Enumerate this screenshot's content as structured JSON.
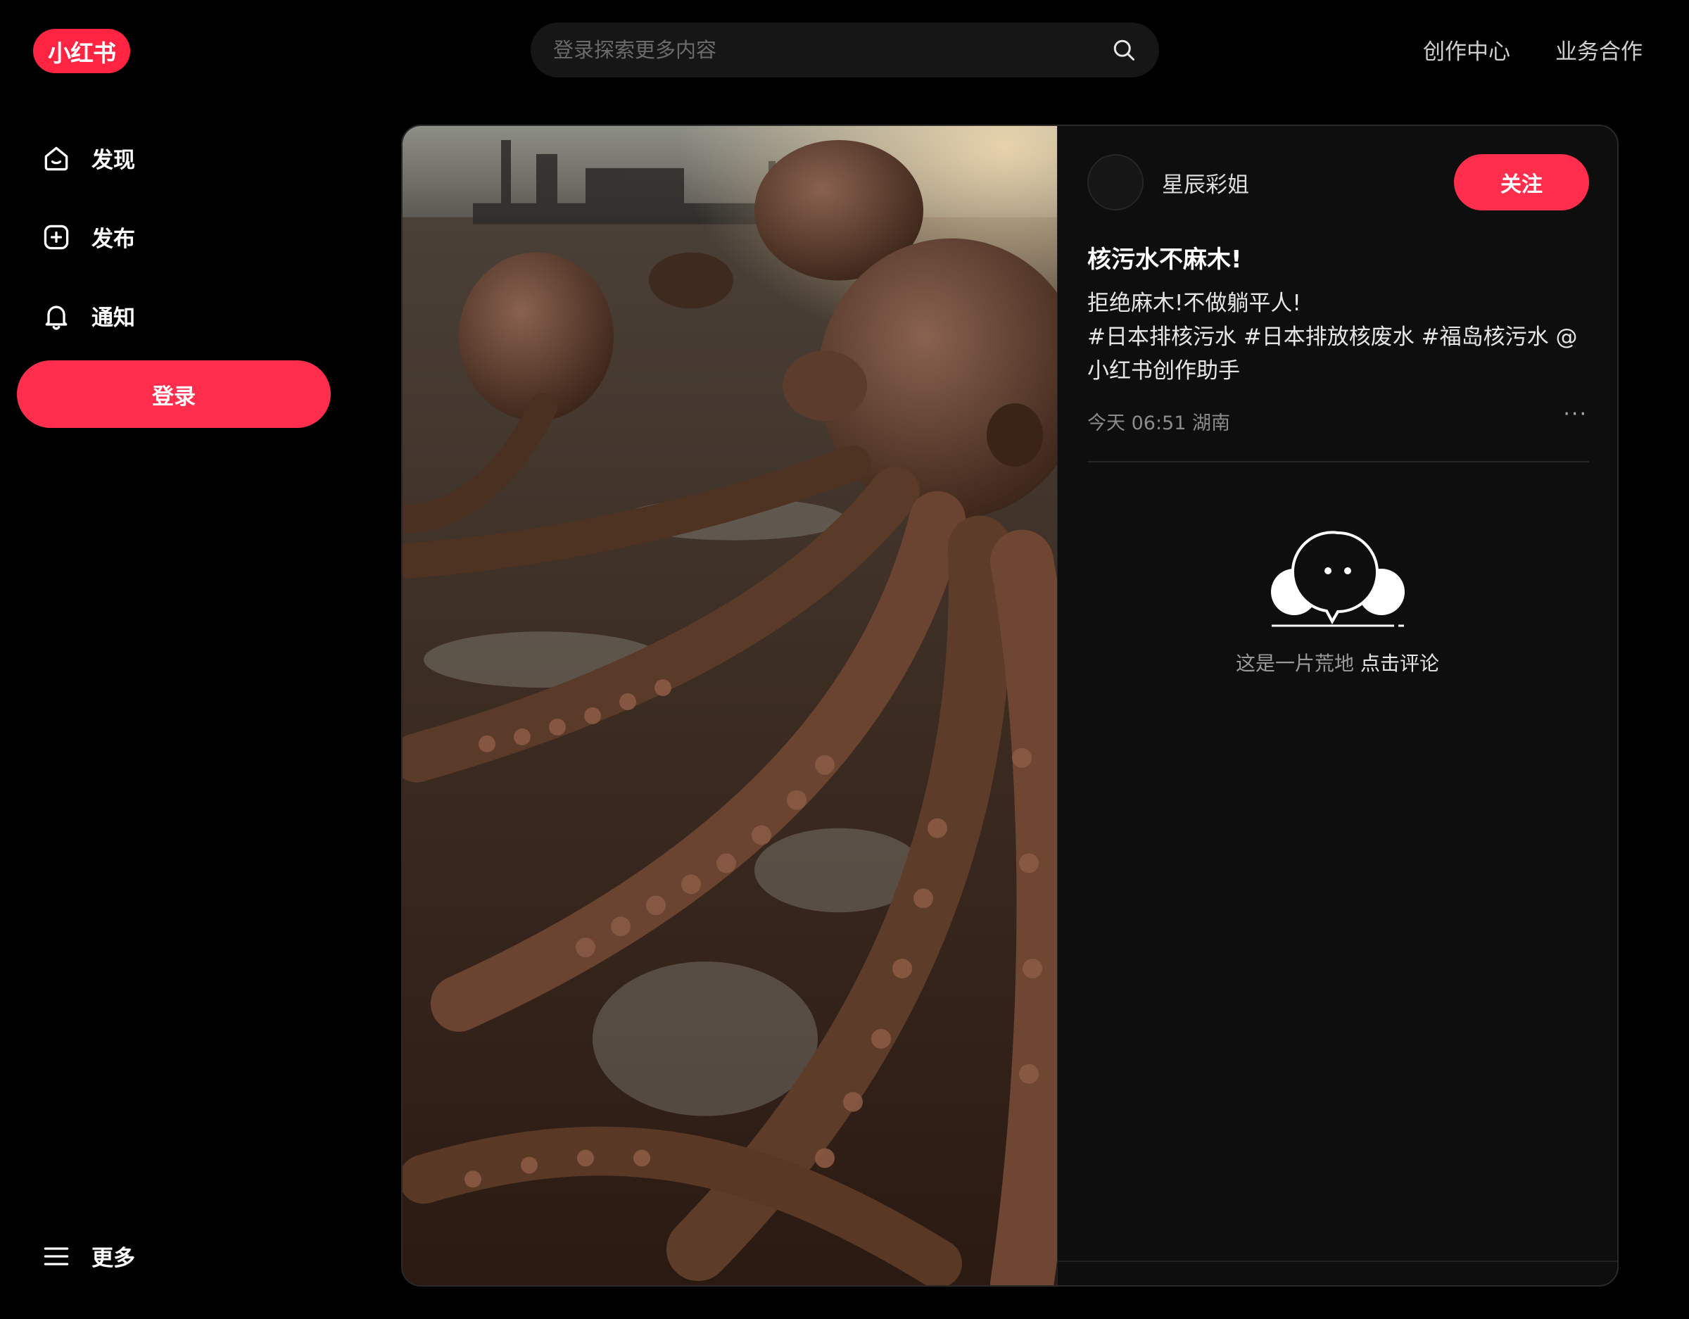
{
  "header": {
    "logo_text": "小红书",
    "search_placeholder": "登录探索更多内容",
    "links": [
      "创作中心",
      "业务合作"
    ]
  },
  "sidebar": {
    "items": [
      {
        "label": "发现",
        "icon": "home-icon"
      },
      {
        "label": "发布",
        "icon": "plus-square-icon"
      },
      {
        "label": "通知",
        "icon": "bell-icon"
      }
    ],
    "login_label": "登录",
    "more_label": "更多"
  },
  "note": {
    "author": "星辰彩姐",
    "follow_label": "关注",
    "title": "核污水不麻木!",
    "desc_line1": "拒绝麻木!不做躺平人!",
    "desc_line2": "#日本排核污水 #日本排放核废水 #福岛核污水 @小红书创作助手",
    "meta": "今天 06:51 湖南",
    "more": "···",
    "empty_text": "这是一片荒地",
    "comment_link": "点击评论"
  },
  "colors": {
    "brand": "#ff2442",
    "button": "#ff2e4d",
    "background": "#000000"
  }
}
